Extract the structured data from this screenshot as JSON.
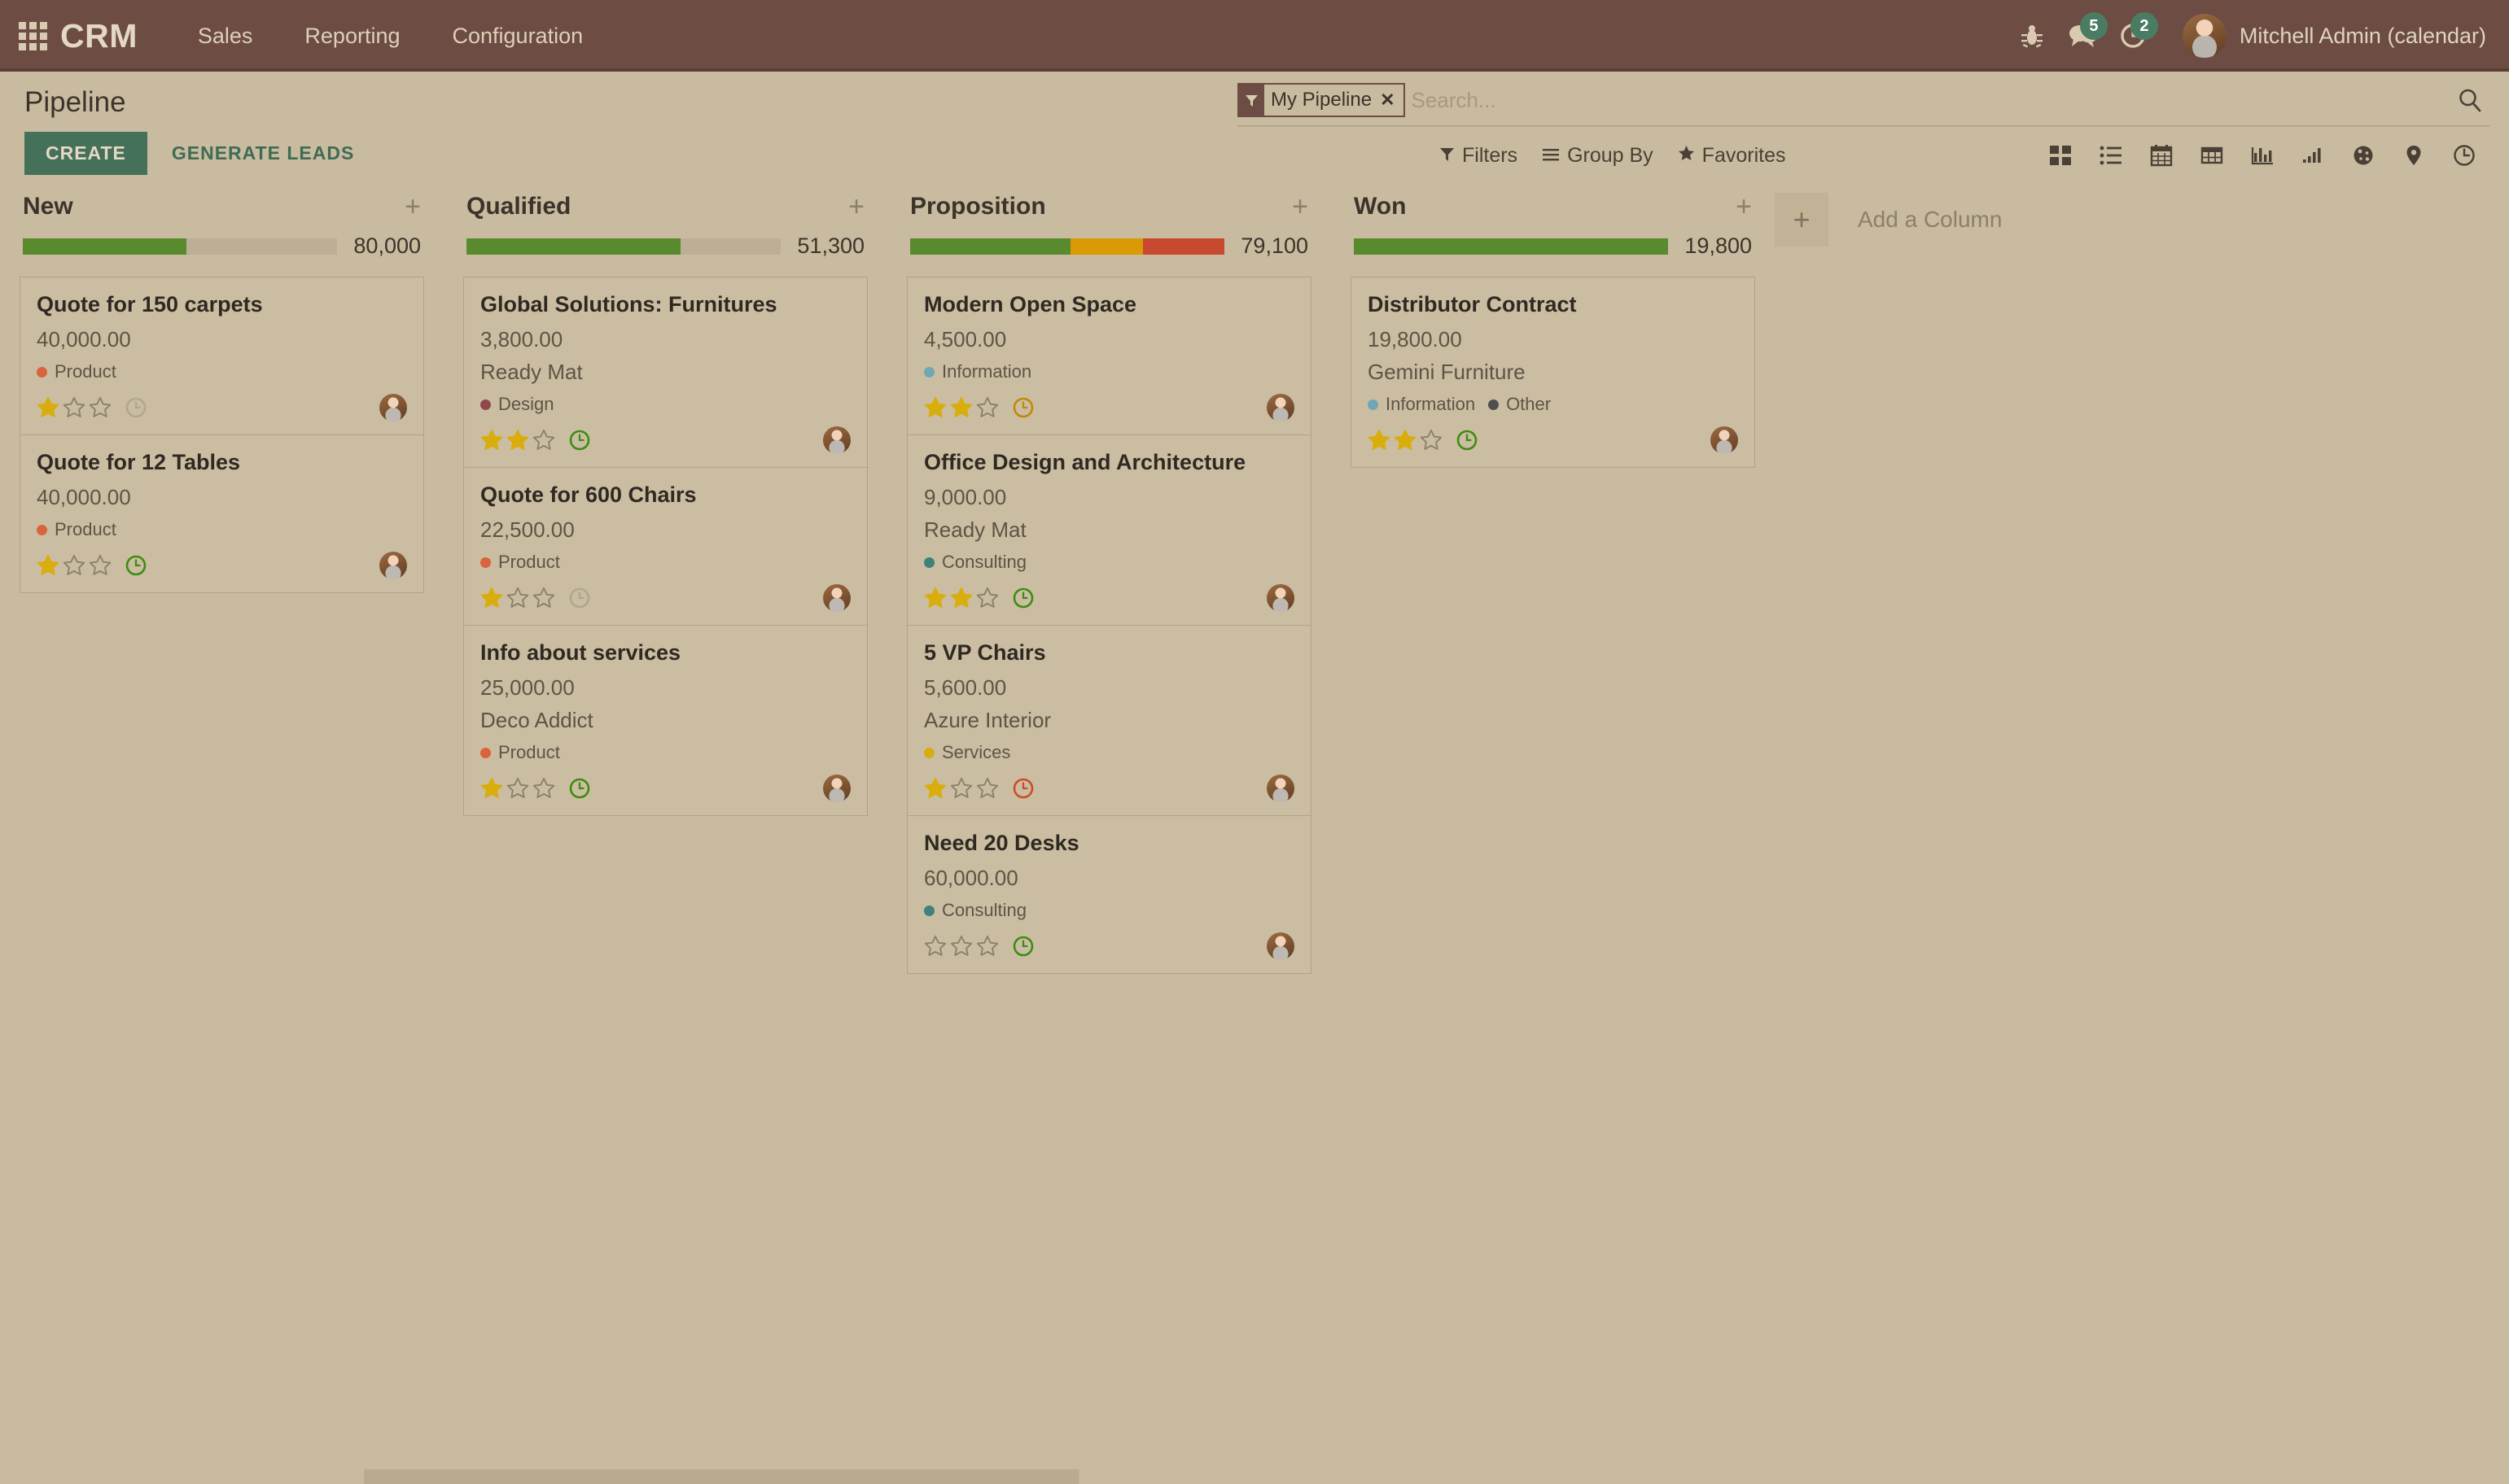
{
  "navbar": {
    "apps_icon": "apps-grid-icon",
    "brand": "CRM",
    "menu": [
      "Sales",
      "Reporting",
      "Configuration"
    ],
    "bug_icon": "bug-icon",
    "messages_icon": "messages-icon",
    "messages_count": "5",
    "activities_icon": "activities-clock-icon",
    "activities_count": "2",
    "user_name": "Mitchell Admin (calendar)",
    "bg_color": "#6d4c43",
    "badge_color": "#4a7c64"
  },
  "control_panel": {
    "page_title": "Pipeline",
    "create_label": "CREATE",
    "generate_leads_label": "GENERATE LEADS",
    "create_bg": "#45705a",
    "search": {
      "facet_label": "My Pipeline",
      "facet_remove": "×",
      "facet_icon": "filter-funnel-icon",
      "placeholder": "Search...",
      "value": "",
      "search_icon": "search-icon"
    },
    "filters": [
      {
        "label": "Filters",
        "icon": "filter-funnel-icon"
      },
      {
        "label": "Group By",
        "icon": "hamburger-lines-icon"
      },
      {
        "label": "Favorites",
        "icon": "star-icon"
      }
    ],
    "views": [
      {
        "name": "kanban-view-icon",
        "active": true
      },
      {
        "name": "list-view-icon",
        "active": false
      },
      {
        "name": "calendar-view-icon",
        "active": false
      },
      {
        "name": "pivot-view-icon",
        "active": false
      },
      {
        "name": "graph-view-icon",
        "active": false
      },
      {
        "name": "cohort-view-icon",
        "active": false
      },
      {
        "name": "dashboard-view-icon",
        "active": false
      },
      {
        "name": "map-view-icon",
        "active": false
      },
      {
        "name": "activity-view-icon",
        "active": false
      }
    ]
  },
  "kanban": {
    "add_column_label": "Add a Column",
    "add_column_plus": "+",
    "column_plus": "+",
    "colors": {
      "green": "#5a8a2e",
      "orange": "#d99a06",
      "red": "#c7492f",
      "track": "#bdaf95"
    },
    "columns": [
      {
        "title": "New",
        "total": "80,000",
        "progress": [
          {
            "color": "#5a8a2e",
            "pct": 52
          }
        ],
        "cards": [
          {
            "title": "Quote for 150 carpets",
            "amount": "40,000.00",
            "partner": "",
            "tags": [
              {
                "label": "Product",
                "color": "#d9633b"
              }
            ],
            "stars": 1,
            "activity": "grey"
          },
          {
            "title": "Quote for 12 Tables",
            "amount": "40,000.00",
            "partner": "",
            "tags": [
              {
                "label": "Product",
                "color": "#d9633b"
              }
            ],
            "stars": 1,
            "activity": "green"
          }
        ]
      },
      {
        "title": "Qualified",
        "total": "51,300",
        "progress": [
          {
            "color": "#5a8a2e",
            "pct": 68
          }
        ],
        "cards": [
          {
            "title": "Global Solutions: Furnitures",
            "amount": "3,800.00",
            "partner": "Ready Mat",
            "tags": [
              {
                "label": "Design",
                "color": "#8e4a4a"
              }
            ],
            "stars": 2,
            "activity": "green"
          },
          {
            "title": "Quote for 600 Chairs",
            "amount": "22,500.00",
            "partner": "",
            "tags": [
              {
                "label": "Product",
                "color": "#d9633b"
              }
            ],
            "stars": 1,
            "activity": "grey"
          },
          {
            "title": "Info about services",
            "amount": "25,000.00",
            "partner": "Deco Addict",
            "tags": [
              {
                "label": "Product",
                "color": "#d9633b"
              }
            ],
            "stars": 1,
            "activity": "green"
          }
        ]
      },
      {
        "title": "Proposition",
        "total": "79,100",
        "progress": [
          {
            "color": "#5a8a2e",
            "pct": 51
          },
          {
            "color": "#d99a06",
            "pct": 23
          },
          {
            "color": "#c7492f",
            "pct": 26
          }
        ],
        "cards": [
          {
            "title": "Modern Open Space",
            "amount": "4,500.00",
            "partner": "",
            "tags": [
              {
                "label": "Information",
                "color": "#71a6b5"
              }
            ],
            "stars": 2,
            "activity": "orange"
          },
          {
            "title": "Office Design and Architecture",
            "amount": "9,000.00",
            "partner": "Ready Mat",
            "tags": [
              {
                "label": "Consulting",
                "color": "#3f8279"
              }
            ],
            "stars": 2,
            "activity": "green"
          },
          {
            "title": "5 VP Chairs",
            "amount": "5,600.00",
            "partner": "Azure Interior",
            "tags": [
              {
                "label": "Services",
                "color": "#d4ad12"
              }
            ],
            "stars": 1,
            "activity": "red"
          },
          {
            "title": "Need 20 Desks",
            "amount": "60,000.00",
            "partner": "",
            "tags": [
              {
                "label": "Consulting",
                "color": "#3f8279"
              }
            ],
            "stars": 0,
            "activity": "green"
          }
        ]
      },
      {
        "title": "Won",
        "total": "19,800",
        "progress": [
          {
            "color": "#5a8a2e",
            "pct": 100
          }
        ],
        "cards": [
          {
            "title": "Distributor Contract",
            "amount": "19,800.00",
            "partner": "Gemini Furniture",
            "tags": [
              {
                "label": "Information",
                "color": "#71a6b5"
              },
              {
                "label": "Other",
                "color": "#4f4f4f"
              }
            ],
            "stars": 2,
            "activity": "green"
          }
        ]
      }
    ]
  }
}
